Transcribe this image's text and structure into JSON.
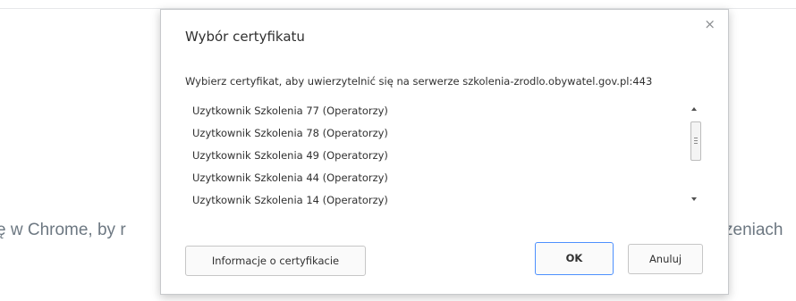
{
  "background": {
    "left_text": "ę w Chrome, by r",
    "right_text": "zeniach"
  },
  "dialog": {
    "title": "Wybór certyfikatu",
    "close_glyph": "×",
    "message": "Wybierz certyfikat, aby uwierzytelnić się na serwerze szkolenia-zrodlo.obywatel.gov.pl:443",
    "certificates": [
      "Uzytkownik Szkolenia 77 (Operatorzy)",
      "Uzytkownik Szkolenia 78 (Operatorzy)",
      "Uzytkownik Szkolenia 49 (Operatorzy)",
      "Uzytkownik Szkolenia 44 (Operatorzy)",
      "Uzytkownik Szkolenia 14 (Operatorzy)"
    ],
    "buttons": {
      "info": "Informacje o certyfikacie",
      "ok": "OK",
      "cancel": "Anuluj"
    }
  },
  "colors": {
    "focus_border": "#4d90fe",
    "text": "#303030",
    "background_text": "#6d7882"
  }
}
